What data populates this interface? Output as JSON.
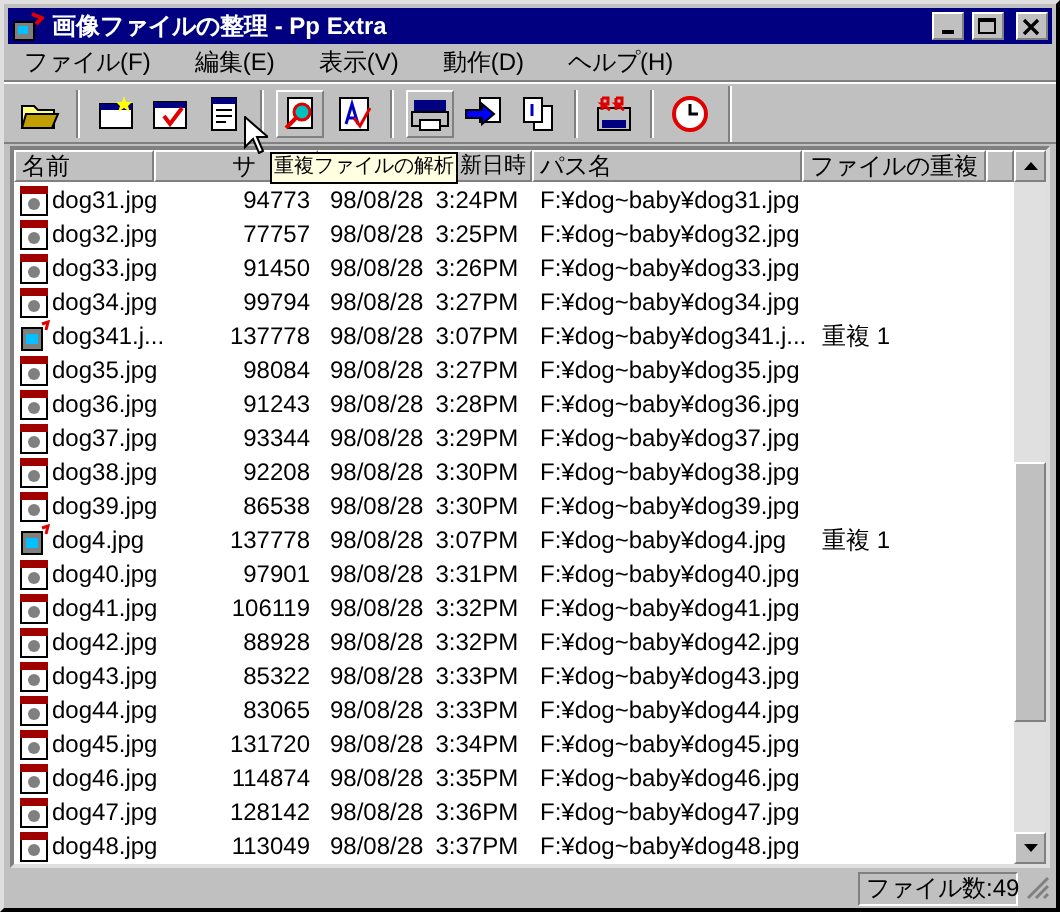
{
  "window": {
    "title": "画像ファイルの整理 - Pp Extra"
  },
  "menu": [
    "ファイル(F)",
    "編集(E)",
    "表示(V)",
    "動作(D)",
    "ヘルプ(H)"
  ],
  "toolbar": [
    [
      {
        "kind": "open",
        "raised": false
      }
    ],
    [
      {
        "kind": "new",
        "raised": false
      },
      {
        "kind": "check",
        "raised": false
      },
      {
        "kind": "form",
        "raised": false
      }
    ],
    [
      {
        "kind": "analyze",
        "raised": true
      },
      {
        "kind": "textcheck",
        "raised": false
      }
    ],
    [
      {
        "kind": "print",
        "raised": true
      },
      {
        "kind": "move",
        "raised": false
      },
      {
        "kind": "copy",
        "raised": false
      }
    ],
    [
      {
        "kind": "rename",
        "raised": false
      }
    ],
    [
      {
        "kind": "clock",
        "raised": false
      }
    ]
  ],
  "tooltip": "重複ファイルの解析",
  "table": {
    "columns": [
      "名前",
      "サ",
      "新日時",
      "パス名",
      "ファイルの重複"
    ],
    "rows": [
      {
        "kind": "jpg",
        "name": "dog31.jpg",
        "size": "94773",
        "date": "98/08/28",
        "time": "3:24PM",
        "path": "F:¥dog~baby¥dog31.jpg"
      },
      {
        "kind": "jpg",
        "name": "dog32.jpg",
        "size": "77757",
        "date": "98/08/28",
        "time": "3:25PM",
        "path": "F:¥dog~baby¥dog32.jpg"
      },
      {
        "kind": "jpg",
        "name": "dog33.jpg",
        "size": "91450",
        "date": "98/08/28",
        "time": "3:26PM",
        "path": "F:¥dog~baby¥dog33.jpg"
      },
      {
        "kind": "jpg",
        "name": "dog34.jpg",
        "size": "99794",
        "date": "98/08/28",
        "time": "3:27PM",
        "path": "F:¥dog~baby¥dog34.jpg"
      },
      {
        "kind": "app",
        "name": "dog341.j...",
        "size": "137778",
        "date": "98/08/28",
        "time": "3:07PM",
        "path": "F:¥dog~baby¥dog341.j...",
        "dup": "重複 1"
      },
      {
        "kind": "jpg",
        "name": "dog35.jpg",
        "size": "98084",
        "date": "98/08/28",
        "time": "3:27PM",
        "path": "F:¥dog~baby¥dog35.jpg"
      },
      {
        "kind": "jpg",
        "name": "dog36.jpg",
        "size": "91243",
        "date": "98/08/28",
        "time": "3:28PM",
        "path": "F:¥dog~baby¥dog36.jpg"
      },
      {
        "kind": "jpg",
        "name": "dog37.jpg",
        "size": "93344",
        "date": "98/08/28",
        "time": "3:29PM",
        "path": "F:¥dog~baby¥dog37.jpg"
      },
      {
        "kind": "jpg",
        "name": "dog38.jpg",
        "size": "92208",
        "date": "98/08/28",
        "time": "3:30PM",
        "path": "F:¥dog~baby¥dog38.jpg"
      },
      {
        "kind": "jpg",
        "name": "dog39.jpg",
        "size": "86538",
        "date": "98/08/28",
        "time": "3:30PM",
        "path": "F:¥dog~baby¥dog39.jpg"
      },
      {
        "kind": "app",
        "name": "dog4.jpg",
        "size": "137778",
        "date": "98/08/28",
        "time": "3:07PM",
        "path": "F:¥dog~baby¥dog4.jpg",
        "dup": "重複 1"
      },
      {
        "kind": "jpg",
        "name": "dog40.jpg",
        "size": "97901",
        "date": "98/08/28",
        "time": "3:31PM",
        "path": "F:¥dog~baby¥dog40.jpg"
      },
      {
        "kind": "jpg",
        "name": "dog41.jpg",
        "size": "106119",
        "date": "98/08/28",
        "time": "3:32PM",
        "path": "F:¥dog~baby¥dog41.jpg"
      },
      {
        "kind": "jpg",
        "name": "dog42.jpg",
        "size": "88928",
        "date": "98/08/28",
        "time": "3:32PM",
        "path": "F:¥dog~baby¥dog42.jpg"
      },
      {
        "kind": "jpg",
        "name": "dog43.jpg",
        "size": "85322",
        "date": "98/08/28",
        "time": "3:33PM",
        "path": "F:¥dog~baby¥dog43.jpg"
      },
      {
        "kind": "jpg",
        "name": "dog44.jpg",
        "size": "83065",
        "date": "98/08/28",
        "time": "3:33PM",
        "path": "F:¥dog~baby¥dog44.jpg"
      },
      {
        "kind": "jpg",
        "name": "dog45.jpg",
        "size": "131720",
        "date": "98/08/28",
        "time": "3:34PM",
        "path": "F:¥dog~baby¥dog45.jpg"
      },
      {
        "kind": "jpg",
        "name": "dog46.jpg",
        "size": "114874",
        "date": "98/08/28",
        "time": "3:35PM",
        "path": "F:¥dog~baby¥dog46.jpg"
      },
      {
        "kind": "jpg",
        "name": "dog47.jpg",
        "size": "128142",
        "date": "98/08/28",
        "time": "3:36PM",
        "path": "F:¥dog~baby¥dog47.jpg"
      },
      {
        "kind": "jpg",
        "name": "dog48.jpg",
        "size": "113049",
        "date": "98/08/28",
        "time": "3:37PM",
        "path": "F:¥dog~baby¥dog48.jpg"
      }
    ]
  },
  "status_bar": {
    "file_count": "ファイル数:49"
  }
}
